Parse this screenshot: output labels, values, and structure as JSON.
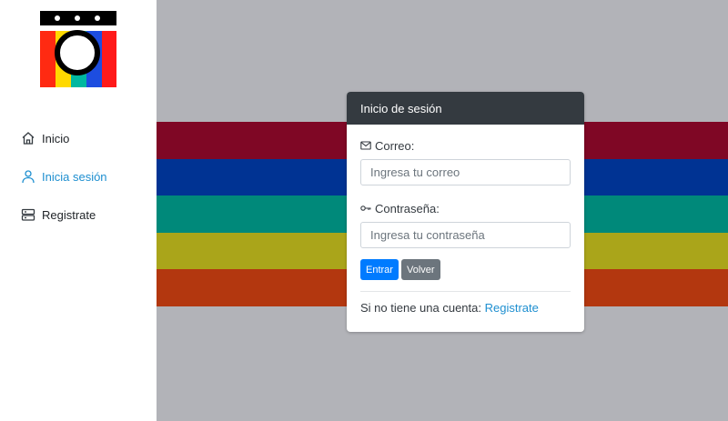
{
  "sidebar": {
    "logo_icon": "camera-logo-icon",
    "items": [
      {
        "label": "Inicio",
        "icon": "home-icon",
        "active": false
      },
      {
        "label": "Inicia sesión",
        "icon": "user-icon",
        "active": true
      },
      {
        "label": "Registrate",
        "icon": "server-icon",
        "active": false
      }
    ]
  },
  "background": {
    "stripes": [
      "#7f0725",
      "#003393",
      "#00897a",
      "#aaa51a",
      "#b3370f"
    ],
    "base_color": "#b2b3b8"
  },
  "login_card": {
    "title": "Inicio de sesión",
    "email_label": "Correo:",
    "email_icon": "envelope-icon",
    "email_placeholder": "Ingresa tu correo",
    "email_value": "",
    "password_label": "Contraseña:",
    "password_icon": "key-icon",
    "password_placeholder": "Ingresa tu contraseña",
    "password_value": "",
    "submit_label": "Entrar",
    "back_label": "Volver",
    "register_prompt": "Si no tiene una cuenta:",
    "register_link": "Registrate"
  },
  "colors": {
    "accent": "#1e8fd0",
    "primary_button": "#007bff",
    "secondary_button": "#6c757d",
    "card_header": "#343a40"
  }
}
